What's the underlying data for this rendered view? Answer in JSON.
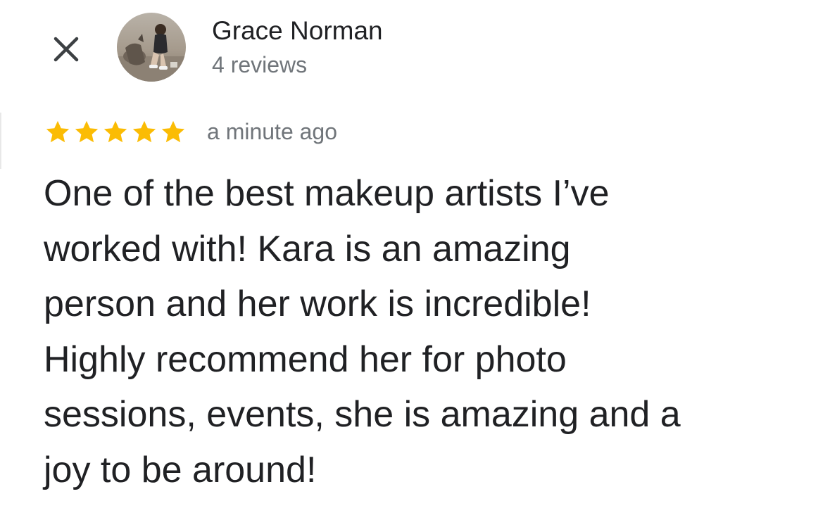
{
  "reviewer": {
    "name": "Grace Norman",
    "review_count": "4 reviews"
  },
  "review": {
    "rating": 5,
    "max_rating": 5,
    "time_ago": "a minute ago",
    "text_lines": [
      "One of the best makeup artists I’ve",
      "worked with! Kara is an amazing",
      "person and her work is incredible!",
      "Highly recommend her for photo",
      "sessions, events, she is amazing and a",
      "joy to be around!"
    ]
  },
  "icons": {
    "close": "close-icon",
    "star": "star-icon"
  },
  "colors": {
    "star": "#fbbc04",
    "primary_text": "#202124",
    "secondary_text": "#70757a"
  }
}
